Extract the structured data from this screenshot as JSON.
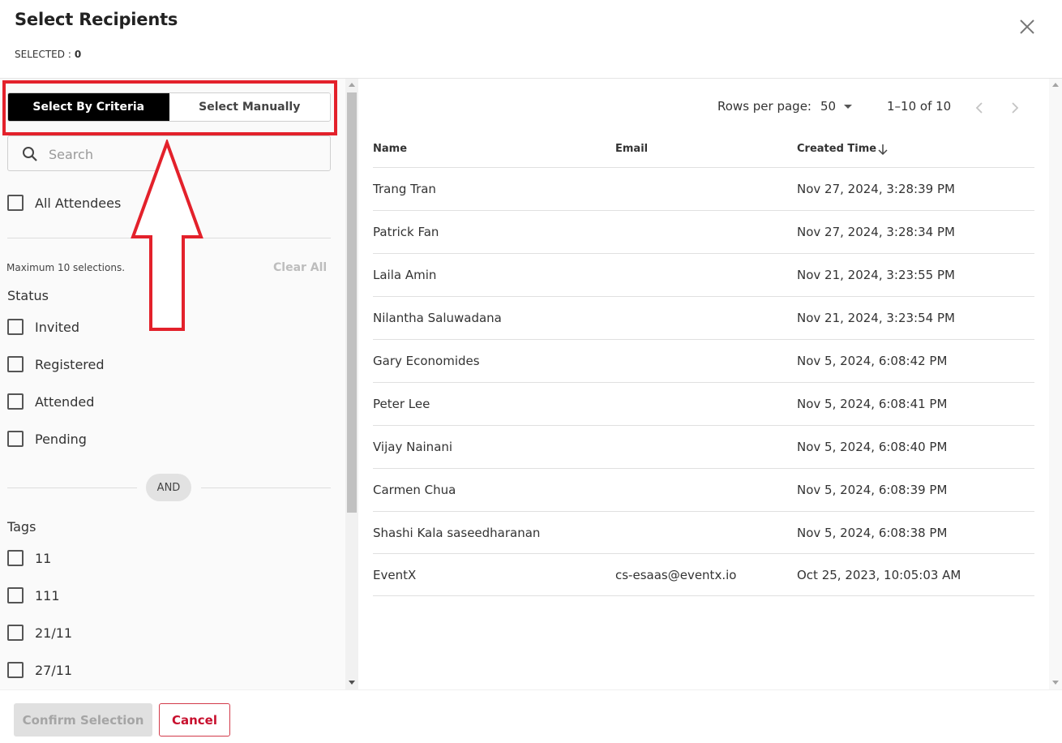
{
  "dialog": {
    "title": "Select Recipients",
    "selected_label": "SELECTED :",
    "selected_count": "0"
  },
  "toggle": {
    "by_criteria": "Select By Criteria",
    "manually": "Select Manually",
    "active": "by_criteria"
  },
  "search": {
    "placeholder": "Search",
    "value": ""
  },
  "all_attendees": {
    "label": "All Attendees",
    "checked": false
  },
  "filters": {
    "max_note": "Maximum 10 selections.",
    "clear_all": "Clear All",
    "status_title": "Status",
    "status": [
      {
        "label": "Invited",
        "checked": false
      },
      {
        "label": "Registered",
        "checked": false
      },
      {
        "label": "Attended",
        "checked": false
      },
      {
        "label": "Pending",
        "checked": false
      }
    ],
    "and_label": "AND",
    "tags_title": "Tags",
    "tags": [
      {
        "label": "11",
        "checked": false
      },
      {
        "label": "111",
        "checked": false
      },
      {
        "label": "21/11",
        "checked": false
      },
      {
        "label": "27/11",
        "checked": false
      }
    ]
  },
  "pager": {
    "rows_label": "Rows per page:",
    "rows_value": "50",
    "range": "1–10 of 10"
  },
  "table": {
    "headers": {
      "name": "Name",
      "email": "Email",
      "created": "Created Time"
    },
    "rows": [
      {
        "name": "Trang Tran",
        "email": "",
        "created": "Nov 27, 2024, 3:28:39 PM"
      },
      {
        "name": "Patrick Fan",
        "email": "",
        "created": "Nov 27, 2024, 3:28:34 PM"
      },
      {
        "name": "Laila Amin",
        "email": "",
        "created": "Nov 21, 2024, 3:23:55 PM"
      },
      {
        "name": "Nilantha Saluwadana",
        "email": "",
        "created": "Nov 21, 2024, 3:23:54 PM"
      },
      {
        "name": "Gary Economides",
        "email": "",
        "created": "Nov 5, 2024, 6:08:42 PM"
      },
      {
        "name": "Peter Lee",
        "email": "",
        "created": "Nov 5, 2024, 6:08:41 PM"
      },
      {
        "name": "Vijay Nainani",
        "email": "",
        "created": "Nov 5, 2024, 6:08:40 PM"
      },
      {
        "name": "Carmen Chua",
        "email": "",
        "created": "Nov 5, 2024, 6:08:39 PM"
      },
      {
        "name": "Shashi Kala saseedharanan",
        "email": "",
        "created": "Nov 5, 2024, 6:08:38 PM"
      },
      {
        "name": "EventX",
        "email": "cs-esaas@eventx.io",
        "created": "Oct 25, 2023, 10:05:03 AM"
      }
    ]
  },
  "footer": {
    "confirm": "Confirm Selection",
    "cancel": "Cancel"
  },
  "colors": {
    "highlight_red": "#e3212b",
    "cancel_red": "#c8102e",
    "active_toggle": "#000000"
  },
  "icons": [
    "close-icon",
    "search-icon",
    "sort-arrow-down-icon",
    "chevron-left-icon",
    "chevron-right-icon",
    "caret-down-icon",
    "up-arrow-annotation"
  ]
}
